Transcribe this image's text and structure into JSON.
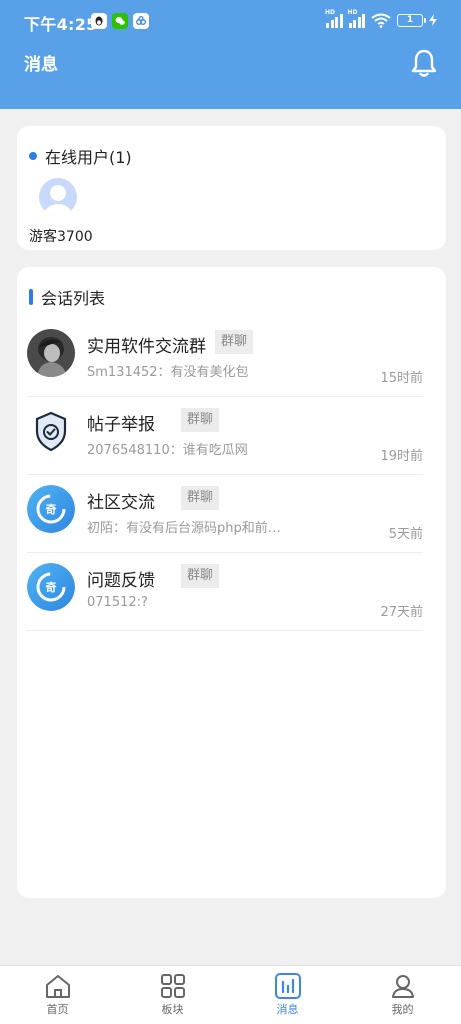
{
  "status_bar": {
    "time": "下午4:25",
    "battery": "1"
  },
  "header": {
    "title": "消息"
  },
  "online": {
    "title": "在线用户(1)",
    "users": [
      {
        "name": "游客3700"
      }
    ]
  },
  "sessions": {
    "title": "会话列表",
    "items": [
      {
        "name": "实用软件交流群",
        "badge": "群聊",
        "preview": "Sm131452：有没有美化包",
        "time": "15时前",
        "avatar": "photo-avatar"
      },
      {
        "name": "帖子举报",
        "badge": "群聊",
        "preview": "2076548110：谁有吃瓜网",
        "time": "19时前",
        "avatar": "shield-check-avatar"
      },
      {
        "name": "社区交流",
        "badge": "群聊",
        "preview": "初陌：有没有后台源码php和前…",
        "time": "5天前",
        "avatar": "qi-logo-avatar"
      },
      {
        "name": "问题反馈",
        "badge": "群聊",
        "preview": "071512:?",
        "time": "27天前",
        "avatar": "qi-logo-avatar"
      }
    ]
  },
  "tabbar": {
    "items": [
      {
        "label": "首页",
        "icon": "home-icon"
      },
      {
        "label": "板块",
        "icon": "grid-icon"
      },
      {
        "label": "消息",
        "icon": "message-chart-icon",
        "active": true
      },
      {
        "label": "我的",
        "icon": "user-icon"
      }
    ]
  },
  "colors": {
    "header": "#58a0e8",
    "accent": "#2d7de8",
    "active_tab": "#3b86e6"
  }
}
